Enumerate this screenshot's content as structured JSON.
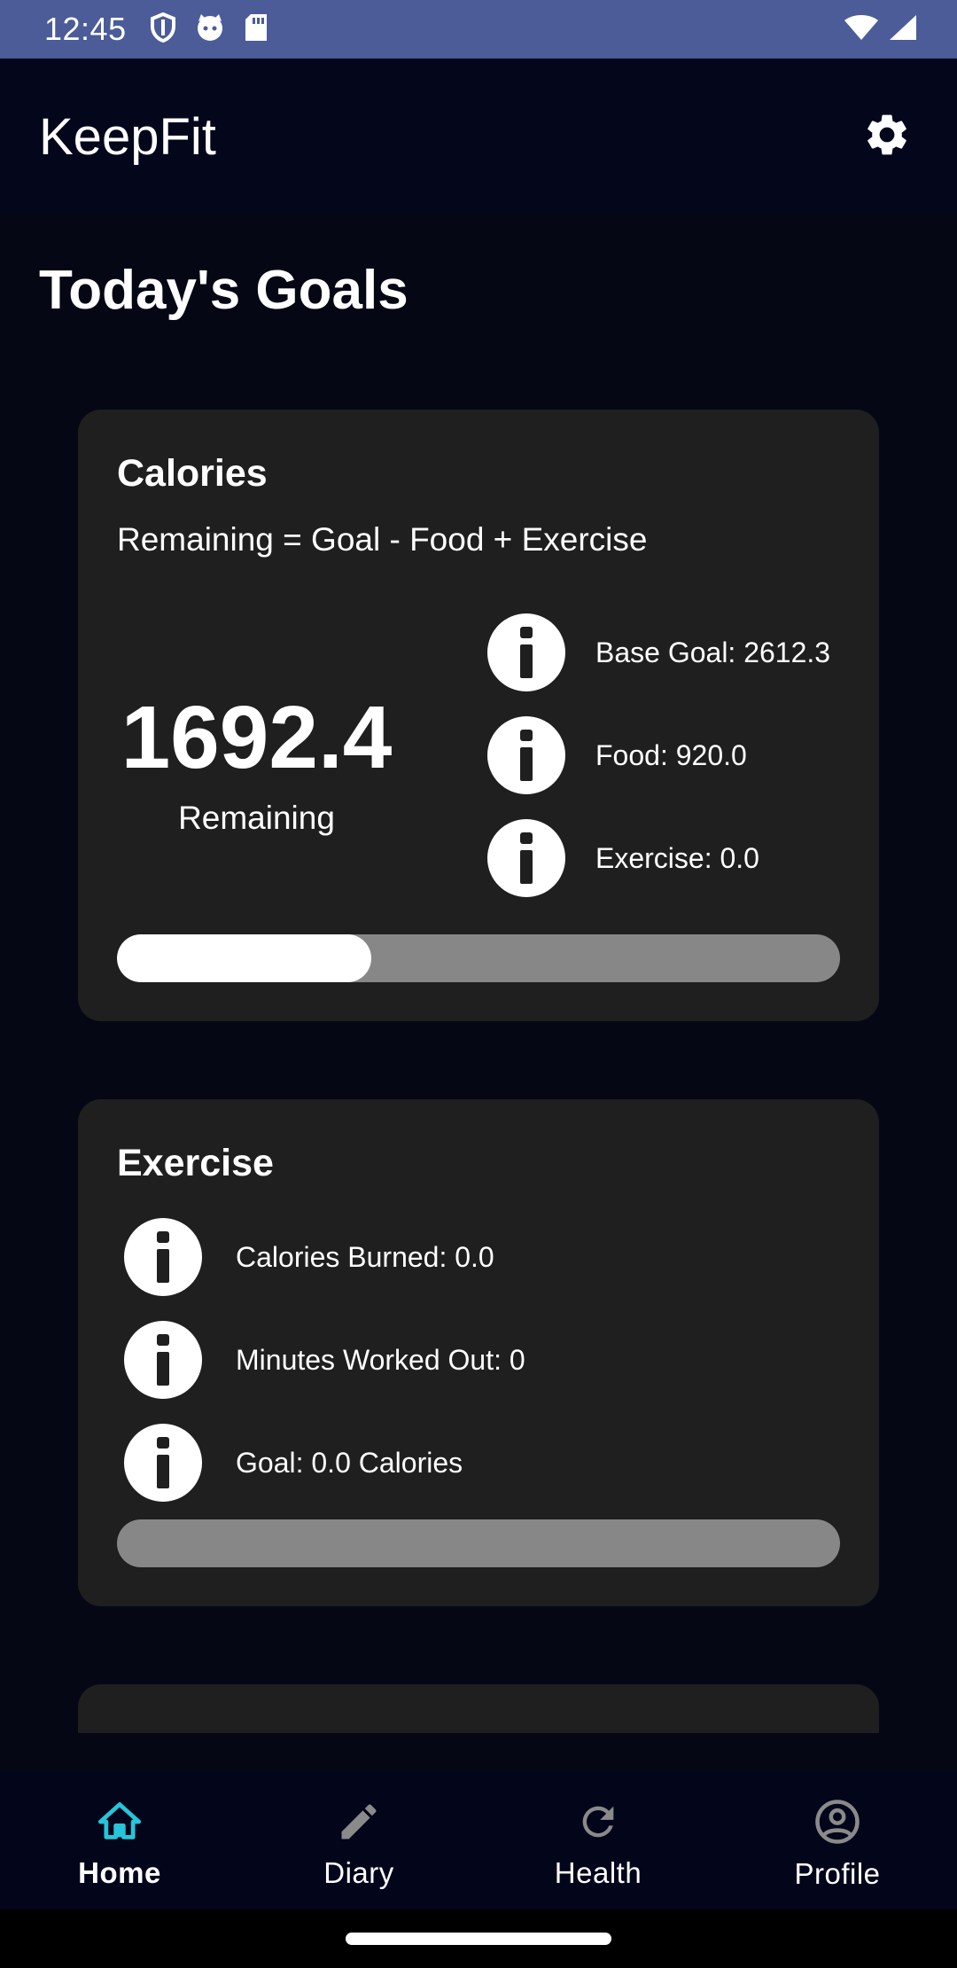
{
  "status_bar": {
    "time": "12:45",
    "left_icons": [
      "shield-icon",
      "cat-icon",
      "sd-card-icon"
    ],
    "right_icons": [
      "wifi-icon",
      "signal-icon"
    ]
  },
  "app_bar": {
    "title": "KeepFit",
    "settings_icon": "gear-icon"
  },
  "page": {
    "title": "Today's Goals"
  },
  "calories_card": {
    "title": "Calories",
    "formula": "Remaining = Goal - Food + Exercise",
    "remaining_value": "1692.4",
    "remaining_label": "Remaining",
    "details": [
      {
        "icon": "info-icon",
        "text": "Base Goal: 2612.3"
      },
      {
        "icon": "info-icon",
        "text": "Food: 920.0"
      },
      {
        "icon": "info-icon",
        "text": "Exercise: 0.0"
      }
    ],
    "progress_fraction": 0.352
  },
  "exercise_card": {
    "title": "Exercise",
    "details": [
      {
        "icon": "info-icon",
        "text": "Calories Burned: 0.0"
      },
      {
        "icon": "info-icon",
        "text": "Minutes Worked Out: 0"
      },
      {
        "icon": "info-icon",
        "text": "Goal: 0.0 Calories"
      }
    ],
    "progress_fraction": 0.0
  },
  "bottom_nav": {
    "items": [
      {
        "label": "Home",
        "icon": "home-icon",
        "active": true
      },
      {
        "label": "Diary",
        "icon": "pencil-icon",
        "active": false
      },
      {
        "label": "Health",
        "icon": "refresh-icon",
        "active": false
      },
      {
        "label": "Profile",
        "icon": "profile-icon",
        "active": false
      }
    ]
  },
  "colors": {
    "status_bar": "#4c5c98",
    "app_bar": "#04061c",
    "background": "#050814",
    "card": "#1f1f1f",
    "progress_track": "#878787",
    "progress_fill": "#ffffff",
    "nav_active": "#26c6da",
    "nav_inactive": "#ffffff"
  }
}
